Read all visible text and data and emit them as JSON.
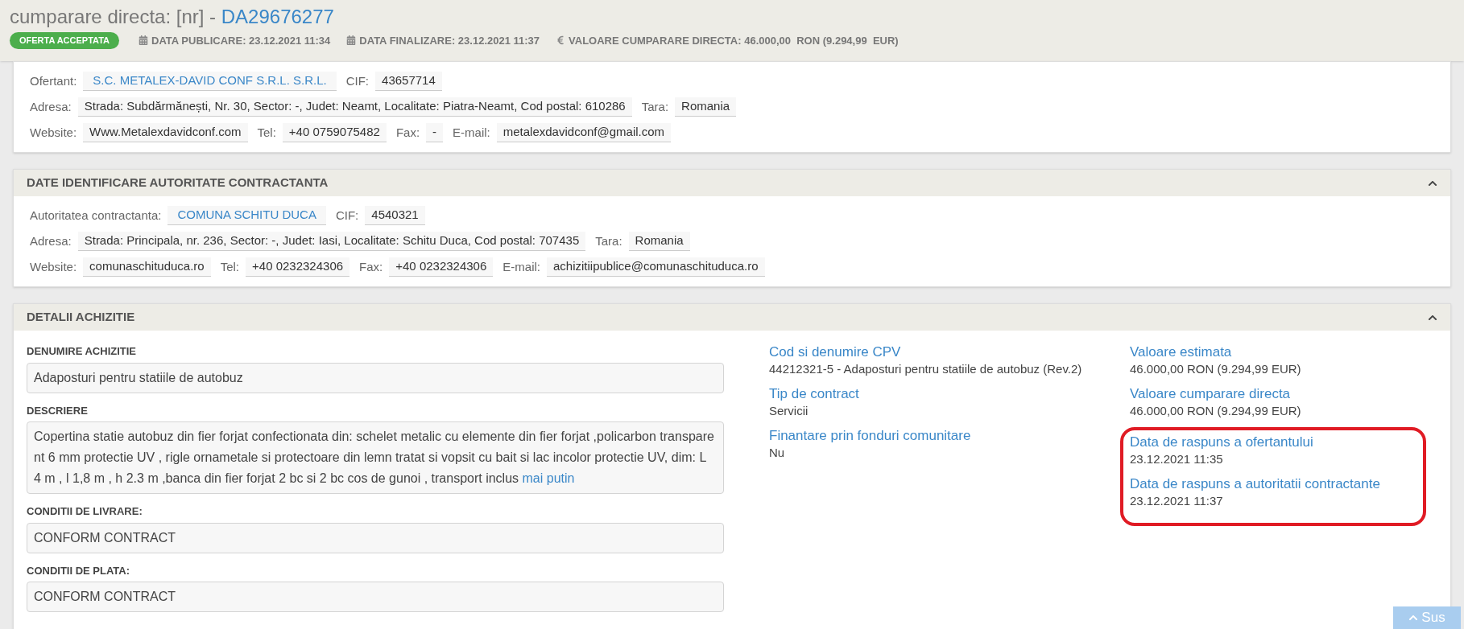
{
  "header": {
    "title_prefix": "cumparare directa: [nr] - ",
    "title_code": "DA29676277",
    "status": "OFERTA ACCEPTATA",
    "meta": [
      {
        "kind": "calendar",
        "text": "DATA PUBLICARE: 23.12.2021 11:34"
      },
      {
        "kind": "calendar",
        "text": "DATA FINALIZARE: 23.12.2021 11:37"
      },
      {
        "kind": "euro",
        "text": "VALOARE CUMPARARE DIRECTA: 46.000,00  RON (9.294,99  EUR)"
      }
    ]
  },
  "sections": [
    {
      "lines": [
        {
          "fields": [
            {
              "label": "Ofertant:",
              "value": "S.C. METALEX-DAVID CONF S.R.L. S.R.L.",
              "kind": "link"
            },
            {
              "label": "CIF:",
              "value": "43657714",
              "kind": "text"
            }
          ]
        },
        {
          "fields": [
            {
              "label": "Adresa:",
              "value": "Strada: Subdărmănești, Nr. 30, Sector: -, Judet: Neamt, Localitate: Piatra-Neamt, Cod postal: 610286",
              "kind": "text"
            },
            {
              "label": "Tara:",
              "value": "Romania",
              "kind": "text"
            }
          ]
        },
        {
          "fields": [
            {
              "label": "Website:",
              "value": "Www.Metalexdavidconf.com",
              "kind": "text"
            },
            {
              "label": "Tel:",
              "value": "+40 0759075482",
              "kind": "text"
            },
            {
              "label": "Fax:",
              "value": "-",
              "kind": "text"
            },
            {
              "label": "E-mail:",
              "value": "metalexdavidconf@gmail.com",
              "kind": "text"
            }
          ]
        }
      ]
    },
    {
      "title": "DATE IDENTIFICARE AUTORITATE CONTRACTANTA",
      "collapsible": true,
      "lines": [
        {
          "fields": [
            {
              "label": "Autoritatea contractanta:",
              "value": "COMUNA SCHITU DUCA",
              "kind": "link"
            },
            {
              "label": "CIF:",
              "value": "4540321",
              "kind": "text"
            }
          ]
        },
        {
          "fields": [
            {
              "label": "Adresa:",
              "value": "Strada: Principala, nr. 236, Sector: -, Judet: Iasi, Localitate: Schitu Duca, Cod postal: 707435",
              "kind": "text"
            },
            {
              "label": "Tara:",
              "value": "Romania",
              "kind": "text"
            }
          ]
        },
        {
          "fields": [
            {
              "label": "Website:",
              "value": "comunaschituduca.ro",
              "kind": "text"
            },
            {
              "label": "Tel:",
              "value": "+40 0232324306",
              "kind": "text"
            },
            {
              "label": "Fax:",
              "value": "+40 0232324306",
              "kind": "text"
            },
            {
              "label": "E-mail:",
              "value": "achizitiipublice@comunaschituduca.ro",
              "kind": "text"
            }
          ]
        }
      ]
    }
  ],
  "details": {
    "title": "DETALII ACHIZITIE",
    "collapsible": true,
    "fields": [
      {
        "label": "DENUMIRE ACHIZITIE",
        "value": "Adaposturi pentru statiile de autobuz"
      },
      {
        "label": "DESCRIERE",
        "value": "Copertina statie autobuz din fier forjat confectionata din: schelet metalic cu elemente din fier forjat ,policarbon transparent 6 mm protectie UV , rigle ornametale si protectoare din lemn tratat si vopsit cu bait si lac incolor protectie UV, dim: L 4 m , l 1,8 m , h 2.3 m ,banca din fier forjat 2 bc si 2 bc cos de gunoi , transport inclus",
        "link": "mai putin"
      },
      {
        "label": "CONDITII DE LIVRARE:",
        "value": "CONFORM CONTRACT"
      },
      {
        "label": "CONDITII DE PLATA:",
        "value": "CONFORM CONTRACT"
      }
    ],
    "middle": [
      {
        "label": "Cod si denumire CPV",
        "value": "44212321-5 - Adaposturi pentru statiile de autobuz (Rev.2)"
      },
      {
        "label": "Tip de contract",
        "value": "Servicii"
      },
      {
        "label": "Finantare prin fonduri comunitare",
        "value": "Nu"
      }
    ],
    "right": [
      {
        "label": "Valoare estimata",
        "value": "46.000,00  RON (9.294,99  EUR)"
      },
      {
        "label": "Valoare cumparare directa",
        "value": "46.000,00  RON (9.294,99  EUR)"
      }
    ],
    "highlighted": [
      {
        "label": "Data de raspuns a ofertantului",
        "value": "23.12.2021 11:35"
      },
      {
        "label": "Data de raspuns a autoritatii contractante",
        "value": "23.12.2021 11:37"
      }
    ]
  },
  "scroll_top": "Sus"
}
